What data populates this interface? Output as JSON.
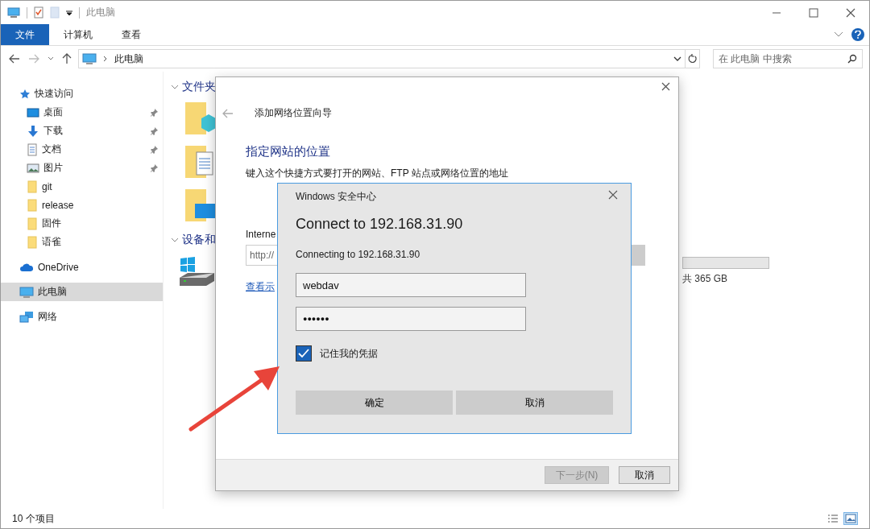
{
  "window": {
    "title": "此电脑"
  },
  "ribbon_tabs": [
    {
      "label": "文件",
      "selected": true
    },
    {
      "label": "计算机",
      "selected": false
    },
    {
      "label": "查看",
      "selected": false
    }
  ],
  "address": {
    "path": "此电脑",
    "search_placeholder": "在 此电脑 中搜索"
  },
  "sidebar": {
    "items": [
      {
        "label": "快速访问",
        "kind": "star",
        "selected": false,
        "children": [
          {
            "label": "桌面",
            "kind": "desktop",
            "pinned": true,
            "selected": false
          },
          {
            "label": "下载",
            "kind": "download",
            "pinned": true,
            "selected": false
          },
          {
            "label": "文档",
            "kind": "document",
            "pinned": true,
            "selected": false
          },
          {
            "label": "图片",
            "kind": "picture",
            "pinned": true,
            "selected": false
          },
          {
            "label": "git",
            "kind": "folder",
            "pinned": false,
            "selected": false
          },
          {
            "label": "release",
            "kind": "folder",
            "pinned": false,
            "selected": false
          },
          {
            "label": "固件",
            "kind": "folder",
            "pinned": false,
            "selected": false
          },
          {
            "label": "语雀",
            "kind": "folder",
            "pinned": false,
            "selected": false
          }
        ]
      },
      {
        "label": "OneDrive",
        "kind": "cloud",
        "selected": false
      },
      {
        "label": "此电脑",
        "kind": "computer",
        "selected": true
      },
      {
        "label": "网络",
        "kind": "network",
        "selected": false
      }
    ]
  },
  "sections": [
    {
      "title": "文件夹",
      "expanded": true
    },
    {
      "title": "设备和",
      "expanded": true
    }
  ],
  "drive": {
    "size_text": "共 365 GB"
  },
  "wizard": {
    "title": "添加网络位置向导",
    "heading": "指定网站的位置",
    "instruction": "键入这个快捷方式要打开的网站、FTP 站点或网络位置的地址",
    "address_label": "Interne",
    "address_value": "http://",
    "example_link": "查看示",
    "buttons": [
      {
        "label": "下一步(N)",
        "disabled": true
      },
      {
        "label": "取消",
        "disabled": false
      }
    ]
  },
  "security": {
    "caption": "Windows 安全中心",
    "title": "Connect to 192.168.31.90",
    "message": "Connecting to 192.168.31.90",
    "username": "webdav",
    "password": "●●●●●●",
    "remember": {
      "label": "记住我的凭据",
      "checked": true
    },
    "buttons": [
      "确定",
      "取消"
    ]
  },
  "status_bar": {
    "item_count": "10 个项目",
    "view_buttons": [
      {
        "kind": "details",
        "selected": false
      },
      {
        "kind": "tiles",
        "selected": true
      }
    ]
  }
}
